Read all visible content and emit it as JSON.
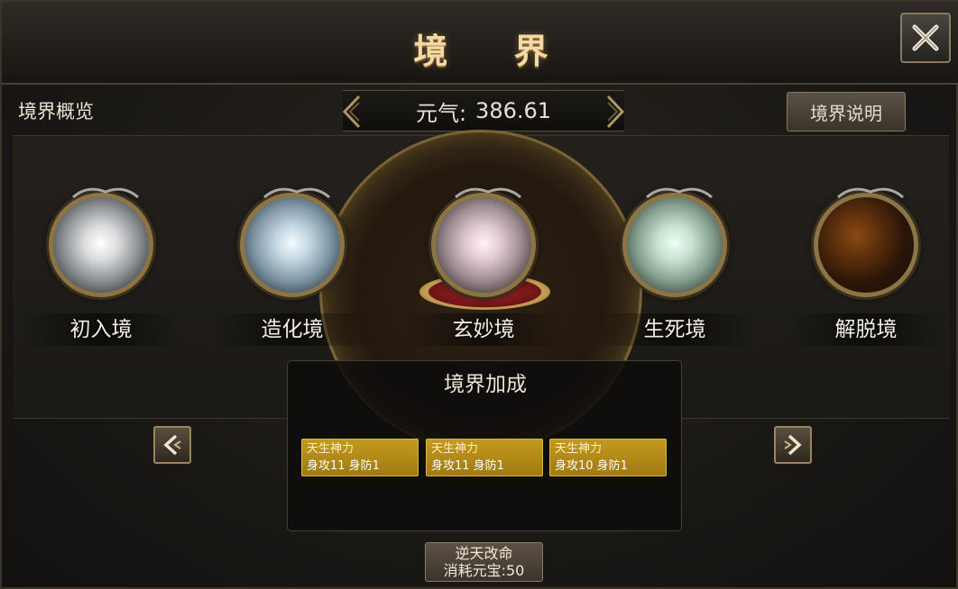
{
  "window": {
    "title": "境 界"
  },
  "header": {
    "overview_label": "境界概览",
    "qi_label": "元气:",
    "qi_value": "386.61",
    "explain_button": "境界说明"
  },
  "realms": [
    {
      "name": "初入境",
      "orb_color": "#d9dbdc"
    },
    {
      "name": "造化境",
      "orb_color": "#c4d6e2"
    },
    {
      "name": "玄妙境",
      "orb_color": "#e2cbd0",
      "selected": true
    },
    {
      "name": "生死境",
      "orb_color": "#c9e2d2"
    },
    {
      "name": "解脱境",
      "orb_color": "#8a4a14"
    }
  ],
  "bonus": {
    "title": "境界加成",
    "cards": [
      {
        "name": "天生神力",
        "stats": "身攻11  身防1"
      },
      {
        "name": "天生神力",
        "stats": "身攻11  身防1"
      },
      {
        "name": "天生神力",
        "stats": "身攻10  身防1"
      }
    ]
  },
  "fate_button": {
    "line1": "逆天改命",
    "line2": "消耗元宝:50"
  },
  "icons": {
    "close": "close-icon",
    "prev": "arrow-left-icon",
    "next": "arrow-right-icon"
  },
  "colors": {
    "gold": "#c39a1f",
    "title": "#f3d9a6",
    "frame": "#8c7445"
  }
}
